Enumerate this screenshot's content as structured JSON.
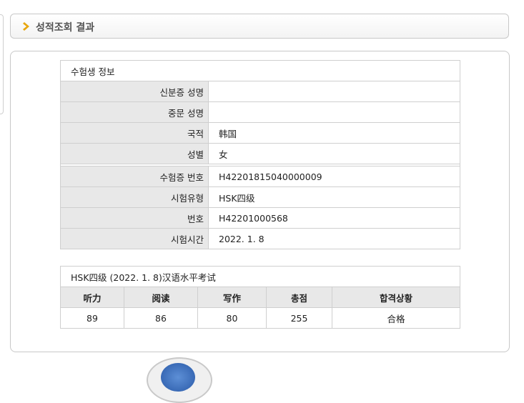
{
  "header": {
    "title": "성적조회 결과"
  },
  "info_table": {
    "caption": "수험생 정보",
    "rows": [
      {
        "label": "신분증 성명",
        "value": ""
      },
      {
        "label": "중문 성명",
        "value": ""
      },
      {
        "label": "국적",
        "value": "韩国"
      },
      {
        "label": "성별",
        "value": "女"
      }
    ],
    "exam_rows": [
      {
        "label": "수험증 번호",
        "value": "H42201815040000009"
      },
      {
        "label": "시험유형",
        "value": "HSK四级"
      },
      {
        "label": "번호",
        "value": "H42201000568"
      },
      {
        "label": "시험시간",
        "value": "2022. 1. 8"
      }
    ]
  },
  "score_table": {
    "caption": "HSK四级 (2022. 1. 8)汉语水平考试",
    "columns": [
      "听力",
      "阅读",
      "写作",
      "총점",
      "합격상황"
    ],
    "values": [
      "89",
      "86",
      "80",
      "255",
      "合格"
    ]
  },
  "colors": {
    "accent_arrow": "#e8a60c",
    "label_bg": "#e8e8e8",
    "border": "#cfcfcf"
  },
  "icons": {
    "title": "chevron-right-icon",
    "seal": "seal-emblem-icon"
  }
}
